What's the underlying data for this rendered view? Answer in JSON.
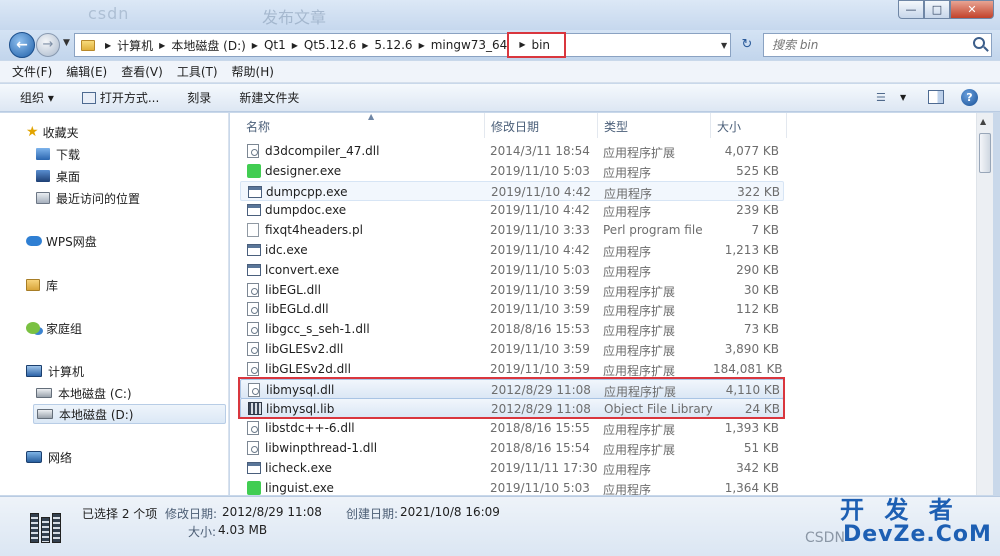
{
  "title_ghost": "csdn",
  "title_ghost2": "发布文章",
  "window_buttons": {
    "min": "—",
    "max": "□",
    "close": "✕"
  },
  "address": {
    "crumbs": [
      "计算机",
      "本地磁盘 (D:)",
      "Qt1",
      "Qt5.12.6",
      "5.12.6",
      "mingw73_64",
      "bin"
    ]
  },
  "search": {
    "placeholder": "搜索 bin"
  },
  "menu": [
    "文件(F)",
    "编辑(E)",
    "查看(V)",
    "工具(T)",
    "帮助(H)"
  ],
  "toolbar": {
    "organize": "组织 ▾",
    "open_with": "打开方式...",
    "burn": "刻录",
    "new_folder": "新建文件夹"
  },
  "nav": {
    "favorites": "收藏夹",
    "downloads": "下载",
    "desktop": "桌面",
    "recent": "最近访问的位置",
    "wps": "WPS网盘",
    "library": "库",
    "homegroup": "家庭组",
    "computer": "计算机",
    "drive_c": "本地磁盘 (C:)",
    "drive_d": "本地磁盘 (D:)",
    "network": "网络"
  },
  "columns": {
    "name": "名称",
    "date": "修改日期",
    "type": "类型",
    "size": "大小"
  },
  "files": [
    {
      "name": "d3dcompiler_47.dll",
      "date": "2014/3/11 18:54",
      "type": "应用程序扩展",
      "size": "4,077 KB",
      "icon": "dll"
    },
    {
      "name": "designer.exe",
      "date": "2019/11/10 5:03",
      "type": "应用程序",
      "size": "525 KB",
      "icon": "qt"
    },
    {
      "name": "dumpcpp.exe",
      "date": "2019/11/10 4:42",
      "type": "应用程序",
      "size": "322 KB",
      "icon": "exe"
    },
    {
      "name": "dumpdoc.exe",
      "date": "2019/11/10 4:42",
      "type": "应用程序",
      "size": "239 KB",
      "icon": "exe"
    },
    {
      "name": "fixqt4headers.pl",
      "date": "2019/11/10 3:33",
      "type": "Perl program file",
      "size": "7 KB",
      "icon": "pl"
    },
    {
      "name": "idc.exe",
      "date": "2019/11/10 4:42",
      "type": "应用程序",
      "size": "1,213 KB",
      "icon": "exe"
    },
    {
      "name": "lconvert.exe",
      "date": "2019/11/10 5:03",
      "type": "应用程序",
      "size": "290 KB",
      "icon": "exe"
    },
    {
      "name": "libEGL.dll",
      "date": "2019/11/10 3:59",
      "type": "应用程序扩展",
      "size": "30 KB",
      "icon": "dll"
    },
    {
      "name": "libEGLd.dll",
      "date": "2019/11/10 3:59",
      "type": "应用程序扩展",
      "size": "112 KB",
      "icon": "dll"
    },
    {
      "name": "libgcc_s_seh-1.dll",
      "date": "2018/8/16 15:53",
      "type": "应用程序扩展",
      "size": "73 KB",
      "icon": "dll"
    },
    {
      "name": "libGLESv2.dll",
      "date": "2019/11/10 3:59",
      "type": "应用程序扩展",
      "size": "3,890 KB",
      "icon": "dll"
    },
    {
      "name": "libGLESv2d.dll",
      "date": "2019/11/10 3:59",
      "type": "应用程序扩展",
      "size": "184,081 KB",
      "icon": "dll"
    },
    {
      "name": "libmysql.dll",
      "date": "2012/8/29 11:08",
      "type": "应用程序扩展",
      "size": "4,110 KB",
      "icon": "dll",
      "selected": true
    },
    {
      "name": "libmysql.lib",
      "date": "2012/8/29 11:08",
      "type": "Object File Library",
      "size": "24 KB",
      "icon": "lib",
      "selected": true
    },
    {
      "name": "libstdc++-6.dll",
      "date": "2018/8/16 15:55",
      "type": "应用程序扩展",
      "size": "1,393 KB",
      "icon": "dll"
    },
    {
      "name": "libwinpthread-1.dll",
      "date": "2018/8/16 15:54",
      "type": "应用程序扩展",
      "size": "51 KB",
      "icon": "dll"
    },
    {
      "name": "licheck.exe",
      "date": "2019/11/11 17:30",
      "type": "应用程序",
      "size": "342 KB",
      "icon": "exe"
    },
    {
      "name": "linguist.exe",
      "date": "2019/11/10 5:03",
      "type": "应用程序",
      "size": "1,364 KB",
      "icon": "qt"
    }
  ],
  "details": {
    "selected": "已选择 2 个项",
    "modified_label": "修改日期:",
    "modified_value": "2012/8/29 11:08",
    "created_label": "创建日期:",
    "created_value": "2021/10/8 16:09",
    "size_label": "大小:",
    "size_value": "4.03 MB"
  },
  "watermark": {
    "line1": "开 发 者",
    "line2": "DevZe.CoM",
    "csdn": "CSDN"
  }
}
